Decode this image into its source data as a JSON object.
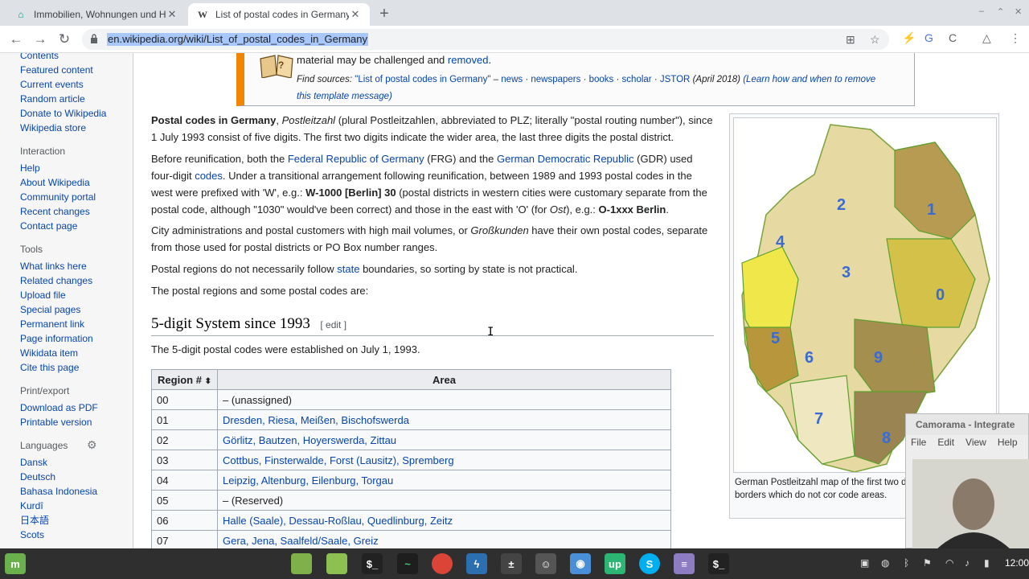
{
  "browser": {
    "tabs": [
      {
        "title": "Immobilien, Wohnungen und Häuser",
        "favicon": "home-icon"
      },
      {
        "title": "List of postal codes in Germany",
        "favicon": "W"
      }
    ],
    "url": "en.wikipedia.org/wiki/List_of_postal_codes_in_Germany"
  },
  "sidebar": {
    "top_items": [
      "Contents",
      "Featured content",
      "Current events",
      "Random article",
      "Donate to Wikipedia",
      "Wikipedia store"
    ],
    "interaction_heading": "Interaction",
    "interaction_items": [
      "Help",
      "About Wikipedia",
      "Community portal",
      "Recent changes",
      "Contact page"
    ],
    "tools_heading": "Tools",
    "tools_items": [
      "What links here",
      "Related changes",
      "Upload file",
      "Special pages",
      "Permanent link",
      "Page information",
      "Wikidata item",
      "Cite this page"
    ],
    "print_heading": "Print/export",
    "print_items": [
      "Download as PDF",
      "Printable version"
    ],
    "languages_heading": "Languages",
    "languages_items": [
      "Dansk",
      "Deutsch",
      "Bahasa Indonesia",
      "Kurdî",
      "日本語",
      "Scots"
    ]
  },
  "ambox": {
    "line1_text": "material may be challenged and",
    "line1_link": "removed",
    "find_sources_label": "Find sources:",
    "find_sources_query": "\"List of postal codes in Germany\"",
    "links": [
      "news",
      "newspapers",
      "books",
      "scholar",
      "JSTOR"
    ],
    "date": "(April 2018)",
    "learn_link": "(Learn how and when to remove this template message)"
  },
  "article": {
    "p1_bold": "Postal codes in Germany",
    "p1_italic": "Postleitzahl",
    "p1_rest": "(plural Postleitzahlen, abbreviated to PLZ; literally \"postal routing number\"), since 1 July 1993 consist of five digits. The first two digits indicate the wider area, the last three digits the postal district.",
    "p2_a": "Before reunification, both the",
    "p2_link1": "Federal Republic of Germany",
    "p2_b": "(FRG) and the",
    "p2_link2": "German Democratic Republic",
    "p2_c": "(GDR) used four-digit",
    "p2_link3": "codes",
    "p2_d": ". Under a transitional arrangement following reunification, between 1989 and 1993 postal codes in the west were prefixed with 'W', e.g.:",
    "p2_bold1": "W-1000 [Berlin] 30",
    "p2_e": "(postal districts in western cities were customary separate from the postal code, although \"1030\" would've been correct) and those in the east with 'O' (for",
    "p2_italic": "Ost",
    "p2_f": "), e.g.:",
    "p2_bold2": "O-1xxx Berlin",
    "p2_g": ".",
    "p3_a": "City administrations and postal customers with high mail volumes, or",
    "p3_italic": "Großkunden",
    "p3_b": "have their own postal codes, separate from those used for postal districts or PO Box number ranges.",
    "p4_a": "Postal regions do not necessarily follow",
    "p4_link": "state",
    "p4_b": "boundaries, so sorting by state is not practical.",
    "p5": "The postal regions and some postal codes are:",
    "section_title": "5-digit System since 1993",
    "section_edit": "[ edit ]",
    "p6": "The 5-digit postal codes were established on July 1, 1993."
  },
  "table": {
    "headers": [
      "Region #",
      "Area"
    ],
    "rows": [
      {
        "code": "00",
        "area": "– (unassigned)",
        "links": false
      },
      {
        "code": "01",
        "area": "Dresden, Riesa, Meißen, Bischofswerda",
        "links": true
      },
      {
        "code": "02",
        "area": "Görlitz, Bautzen, Hoyerswerda, Zittau",
        "links": true
      },
      {
        "code": "03",
        "area": "Cottbus, Finsterwalde, Forst (Lausitz), Spremberg",
        "links": true
      },
      {
        "code": "04",
        "area": "Leipzig, Altenburg, Eilenburg, Torgau",
        "links": true
      },
      {
        "code": "05",
        "area": "– (Reserved)",
        "links": false
      },
      {
        "code": "06",
        "area": "Halle (Saale), Dessau-Roßlau, Quedlinburg, Zeitz",
        "links": true
      },
      {
        "code": "07",
        "area": "Gera, Jena, Saalfeld/Saale, Greiz",
        "links": true
      }
    ]
  },
  "thumb": {
    "caption": "German Postleitzahl map of the first two d lines mark state borders which do not cor code areas.",
    "zone_labels": [
      "0",
      "1",
      "2",
      "3",
      "4",
      "5",
      "6",
      "7",
      "8",
      "9"
    ]
  },
  "camorama": {
    "title": "Camorama - Integrate",
    "menu": [
      "File",
      "Edit",
      "View",
      "Help"
    ]
  },
  "taskbar": {
    "clock": "12:00"
  }
}
